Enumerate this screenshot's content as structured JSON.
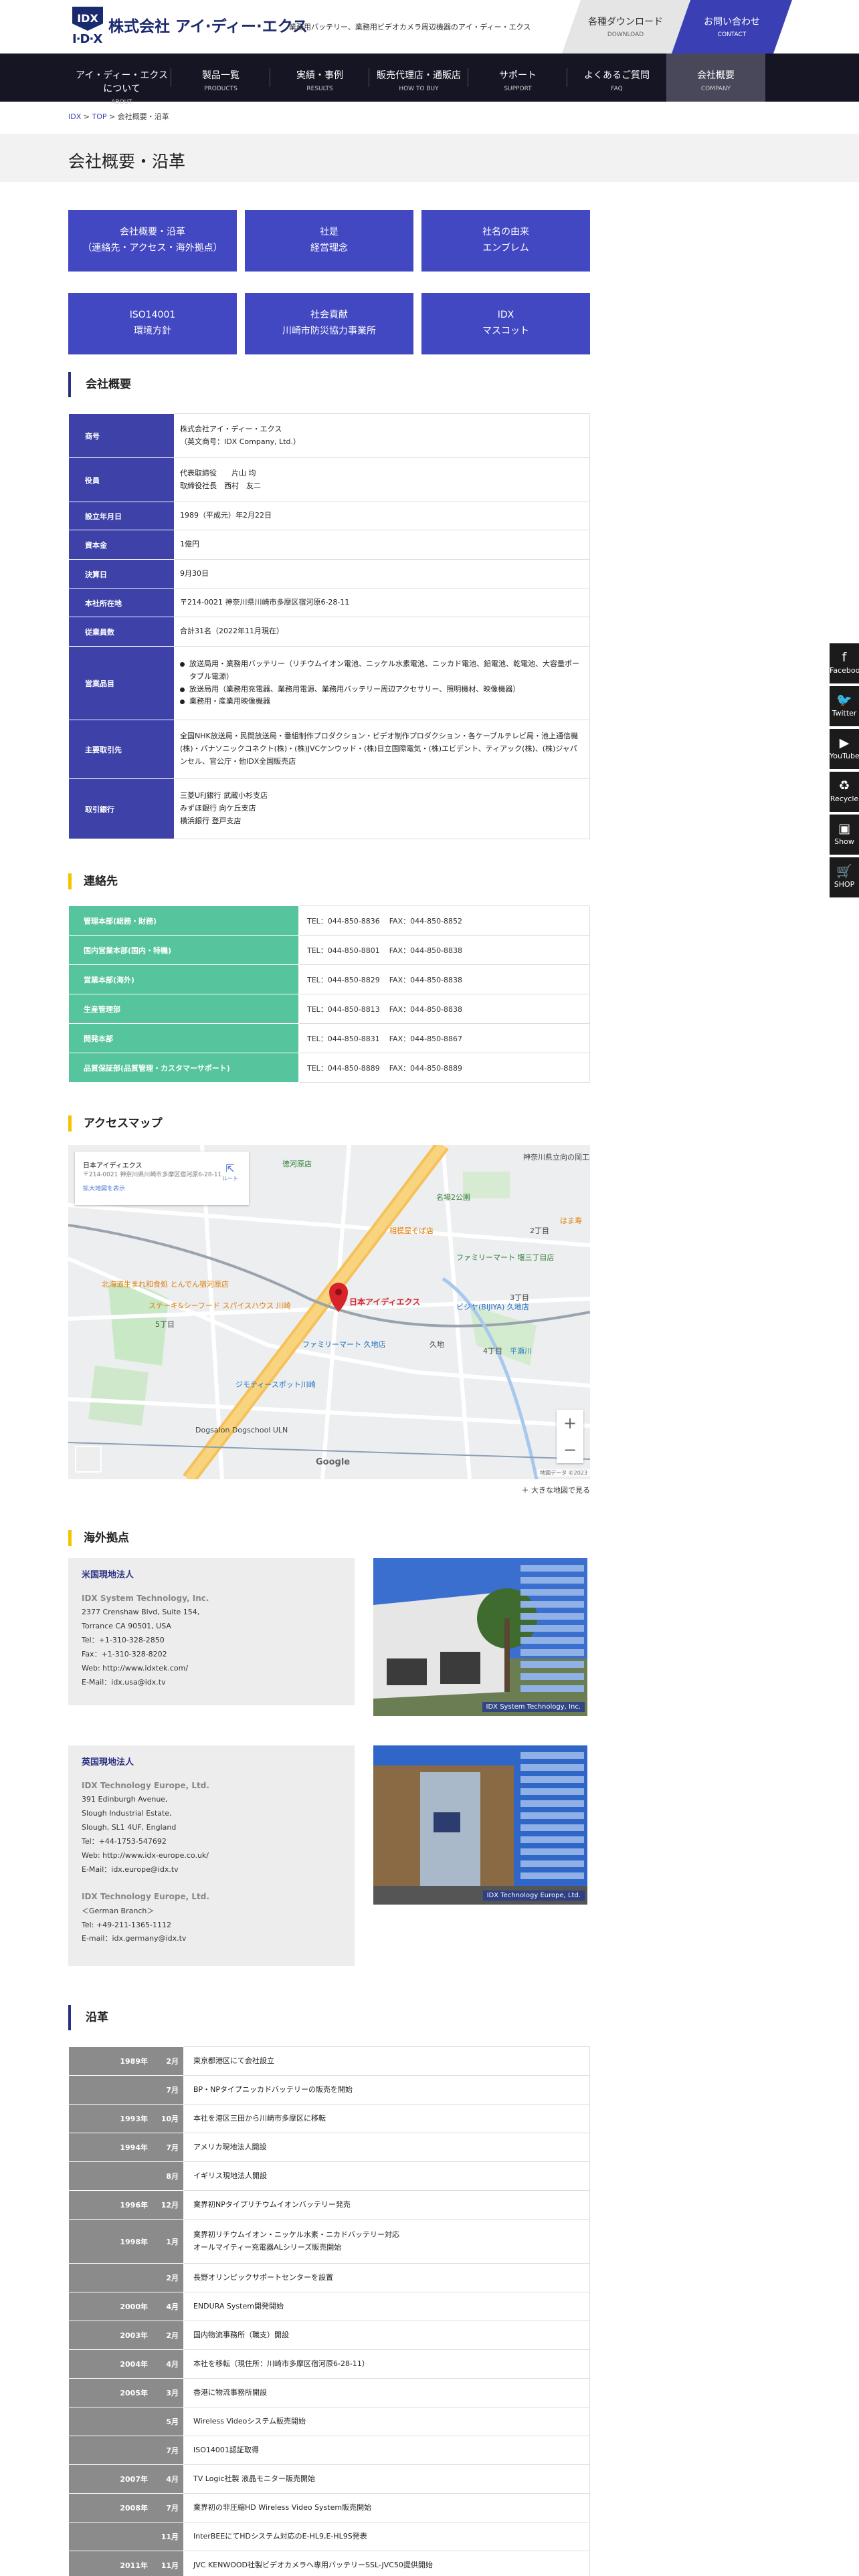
{
  "header": {
    "logo_mark": "I·D·X",
    "logo_emblem": "IDX",
    "logo_name": "株式会社 アイ·ディー·エクス",
    "tagline": "業務用バッテリー、業務用ビデオカメラ周辺機器のアイ・ディー・エクス",
    "download": {
      "label": "各種ダウンロード",
      "sub": "DOWNLOAD"
    },
    "contact": {
      "label": "お問い合わせ",
      "sub": "CONTACT"
    }
  },
  "nav": [
    {
      "label": "アイ・ディー・エクスについて",
      "sub": "ABOUT"
    },
    {
      "label": "製品一覧",
      "sub": "PRODUCTS"
    },
    {
      "label": "実績・事例",
      "sub": "RESULTS"
    },
    {
      "label": "販売代理店・通販店",
      "sub": "HOW TO BUY"
    },
    {
      "label": "サポート",
      "sub": "SUPPORT"
    },
    {
      "label": "よくあるご質問",
      "sub": "FAQ"
    },
    {
      "label": "会社概要",
      "sub": "COMPANY"
    }
  ],
  "breadcrumb": {
    "l1": "IDX",
    "sep": " > ",
    "l2": "TOP",
    "current": "会社概要・沿革"
  },
  "page_title": "会社概要・沿革",
  "tiles": [
    {
      "line1": "会社概要・沿革",
      "line2": "（連絡先・アクセス・海外拠点）"
    },
    {
      "line1": "社是",
      "line2": "経営理念"
    },
    {
      "line1": "社名の由来",
      "line2": "エンブレム"
    },
    {
      "line1": "ISO14001",
      "line2": "環境方針"
    },
    {
      "line1": "社会貢献",
      "line2": "川崎市防災協力事業所"
    },
    {
      "line1": "IDX",
      "line2": "マスコット"
    }
  ],
  "company": {
    "heading": "会社概要",
    "rows": [
      {
        "k": "商号",
        "v": [
          "株式会社アイ・ディー・エクス",
          "（英文商号：IDX Company, Ltd.）"
        ]
      },
      {
        "k": "役員",
        "v": [
          "代表取締役　　片山 均",
          "取締役社長　西村　友二"
        ]
      },
      {
        "k": "設立年月日",
        "v": [
          "1989（平成元）年2月22日"
        ]
      },
      {
        "k": "資本金",
        "v": [
          "1億円"
        ]
      },
      {
        "k": "決算日",
        "v": [
          "9月30日"
        ]
      },
      {
        "k": "本社所在地",
        "v": [
          "〒214-0021 神奈川県川崎市多摩区宿河原6-28-11"
        ]
      },
      {
        "k": "従業員数",
        "v": [
          "合計31名（2022年11月現在）"
        ]
      },
      {
        "k": "営業品目",
        "list": [
          "放送局用・業務用バッテリー（リチウムイオン電池、ニッケル水素電池、ニッカド電池、鉛電池、乾電池、大容量ポータブル電源）",
          "放送局用（業務用充電器、業務用電源、業務用バッテリー周辺アクセサリー、照明機材、映像機器）",
          "業務用・産業用映像機器"
        ]
      },
      {
        "k": "主要取引先",
        "v": [
          "全国NHK放送局・民間放送局・番組制作プロダクション・ビデオ制作プロダクション・各ケーブルテレビ局・池上通信機(株)・パナソニックコネクト(株)・(株)JVCケンウッド・(株)日立国際電気・(株)エビデント、ティアック(株)、(株)ジャパンセル、官公庁・他IDX全国販売店"
        ]
      },
      {
        "k": "取引銀行",
        "v": [
          "三菱UFJ銀行 武蔵小杉支店",
          "みずほ銀行 向ケ丘支店",
          "横浜銀行 登戸支店"
        ]
      }
    ]
  },
  "contacts": {
    "heading": "連絡先",
    "rows": [
      {
        "k": "管理本部(総務・財務)",
        "tel": "TEL：044-850-8836",
        "fax": "FAX：044-850-8852"
      },
      {
        "k": "国内営業本部(国内・特機)",
        "tel": "TEL：044-850-8801",
        "fax": "FAX：044-850-8838"
      },
      {
        "k": "営業本部(海外)",
        "tel": "TEL：044-850-8829",
        "fax": "FAX：044-850-8838"
      },
      {
        "k": "生産管理部",
        "tel": "TEL：044-850-8813",
        "fax": "FAX：044-850-8838"
      },
      {
        "k": "開発本部",
        "tel": "TEL：044-850-8831",
        "fax": "FAX：044-850-8867"
      },
      {
        "k": "品質保証部(品質管理・カスタマーサポート)",
        "tel": "TEL：044-850-8889",
        "fax": "FAX：044-850-8889"
      }
    ]
  },
  "access": {
    "heading": "アクセスマップ",
    "info_name": "日本アイディエクス",
    "info_addr": "〒214-0021 神奈川県川崎市多摩区宿河原6-28-11",
    "info_link": "拡大地図を表示",
    "directions": "ルート",
    "marker": "日本アイディエクス",
    "google": "Google",
    "map_footer": "地図データ ©2023",
    "big_link": "＋ 大きな地図で見る",
    "labels": {
      "a": "徳河原店",
      "b": "相模屋そば店",
      "c": "名場2公園",
      "d": "ファミリーマート 堰三丁目店",
      "e": "北海道生まれ和食処 とんでん宿河原店",
      "f": "ステーキ&シーフード スパイスハウス 川崎",
      "g": "ファミリーマート 久地店",
      "h": "ビジヤ(BIJIYA) 久地店",
      "i": "ジモティースポット川崎",
      "j": "Dogsalon Dogschool ULN",
      "k": "平瀬川",
      "l": "久地",
      "m": "はま寿",
      "n": "3丁目",
      "o": "2丁目",
      "p": "4丁目",
      "q": "5丁目",
      "r": "神奈川県立向の岡工業高"
    }
  },
  "overseas": {
    "heading": "海外拠点",
    "us": {
      "title": "米国現地法人",
      "company": "IDX System Technology, Inc.",
      "lines": [
        "2377 Crenshaw Blvd, Suite 154,",
        "Torrance CA 90501, USA",
        "Tel：+1-310-328-2850",
        "Fax：+1-310-328-8202",
        "Web: http://www.idxtek.com/",
        "E-Mail：idx.usa@idx.tv"
      ],
      "caption": "IDX System Technology, Inc."
    },
    "uk": {
      "title": "英国現地法人",
      "company": "IDX Technology Europe, Ltd.",
      "lines": [
        "391 Edinburgh Avenue,",
        "Slough Industrial Estate,",
        "Slough, SL1 4UF, England",
        "Tel：+44-1753-547692",
        "Web: http://www.idx-europe.co.uk/",
        "E-Mail：idx.europe@idx.tv"
      ],
      "company2": "IDX Technology Europe, Ltd.",
      "lines2": [
        "＜German Branch＞",
        "Tel: +49-211-1365-1112",
        "E-mail：idx.germany@idx.tv"
      ],
      "caption": "IDX Technology Europe, Ltd."
    }
  },
  "history": {
    "heading": "沿革",
    "rows": [
      {
        "y": "1989年",
        "m": "2月",
        "t": [
          "東京都港区にて会社設立"
        ]
      },
      {
        "y": "",
        "m": "7月",
        "t": [
          "BP・NPタイプニッカドバッテリーの販売を開始"
        ]
      },
      {
        "y": "1993年",
        "m": "10月",
        "t": [
          "本社を港区三田から川崎市多摩区に移転"
        ]
      },
      {
        "y": "1994年",
        "m": "7月",
        "t": [
          "アメリカ現地法人開設"
        ]
      },
      {
        "y": "",
        "m": "8月",
        "t": [
          "イギリス現地法人開設"
        ]
      },
      {
        "y": "1996年",
        "m": "12月",
        "t": [
          "業界初NPタイプリチウムイオンバッテリー発売"
        ]
      },
      {
        "y": "1998年",
        "m": "1月",
        "t": [
          "業界初リチウムイオン・ニッケル水素・ニカドバッテリー対応",
          "オールマイティー充電器ALシリーズ販売開始"
        ]
      },
      {
        "y": "",
        "m": "2月",
        "t": [
          "長野オリンピックサポートセンターを設置"
        ]
      },
      {
        "y": "2000年",
        "m": "4月",
        "t": [
          "ENDURA System開発開始"
        ]
      },
      {
        "y": "2003年",
        "m": "2月",
        "t": [
          "国内物流事務所（職支）開設"
        ]
      },
      {
        "y": "2004年",
        "m": "4月",
        "t": [
          "本社を移転（現住所：川崎市多摩区宿河原6-28-11）"
        ]
      },
      {
        "y": "2005年",
        "m": "3月",
        "t": [
          "香港に物流事務所開設"
        ]
      },
      {
        "y": "",
        "m": "5月",
        "t": [
          "Wireless Videoシステム販売開始"
        ]
      },
      {
        "y": "",
        "m": "7月",
        "t": [
          "ISO14001認証取得"
        ]
      },
      {
        "y": "2007年",
        "m": "4月",
        "t": [
          "TV Logic社製 液晶モニター販売開始"
        ]
      },
      {
        "y": "2008年",
        "m": "7月",
        "t": [
          "業界初の非圧縮HD Wireless Video System販売開始"
        ]
      },
      {
        "y": "",
        "m": "11月",
        "t": [
          "InterBEEにてHDシステム対応のE-HL9,E-HL9S発表"
        ]
      },
      {
        "y": "2011年",
        "m": "11月",
        "t": [
          "JVC KENWOOD社製ビデオカメラへ専用バッテリーSSL-JVC50提供開始"
        ]
      }
    ]
  },
  "social": [
    {
      "icon": "f",
      "label": "Facebook"
    },
    {
      "icon": "🐦",
      "label": "Twitter"
    },
    {
      "icon": "▶",
      "label": "YouTube"
    },
    {
      "icon": "♻",
      "label": "Recycle"
    },
    {
      "icon": "▣",
      "label": "Show"
    },
    {
      "icon": "🛒",
      "label": "SHOP"
    }
  ],
  "colors": {
    "brand_navy": "#1a2a6e",
    "tile_blue": "#4247c2",
    "contact_green": "#56c49d",
    "heading_yellow": "#f5c400"
  }
}
